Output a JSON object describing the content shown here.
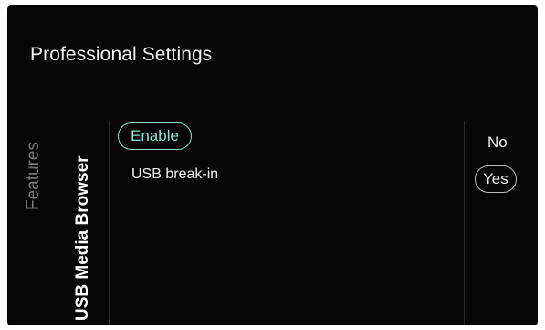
{
  "header": {
    "title": "Professional Settings"
  },
  "breadcrumb": {
    "parent": "Features",
    "current": "USB Media Browser"
  },
  "submenu": {
    "items": [
      {
        "label": "Enable",
        "selected": true
      },
      {
        "label": "USB break-in",
        "selected": false
      }
    ]
  },
  "value_options": {
    "items": [
      {
        "label": "No",
        "selected": false
      },
      {
        "label": "Yes",
        "selected": true
      }
    ]
  },
  "colors": {
    "background": "#060606",
    "accent": "#8ee0d4",
    "text": "#f0f0f0",
    "muted": "#7a7a7a"
  }
}
